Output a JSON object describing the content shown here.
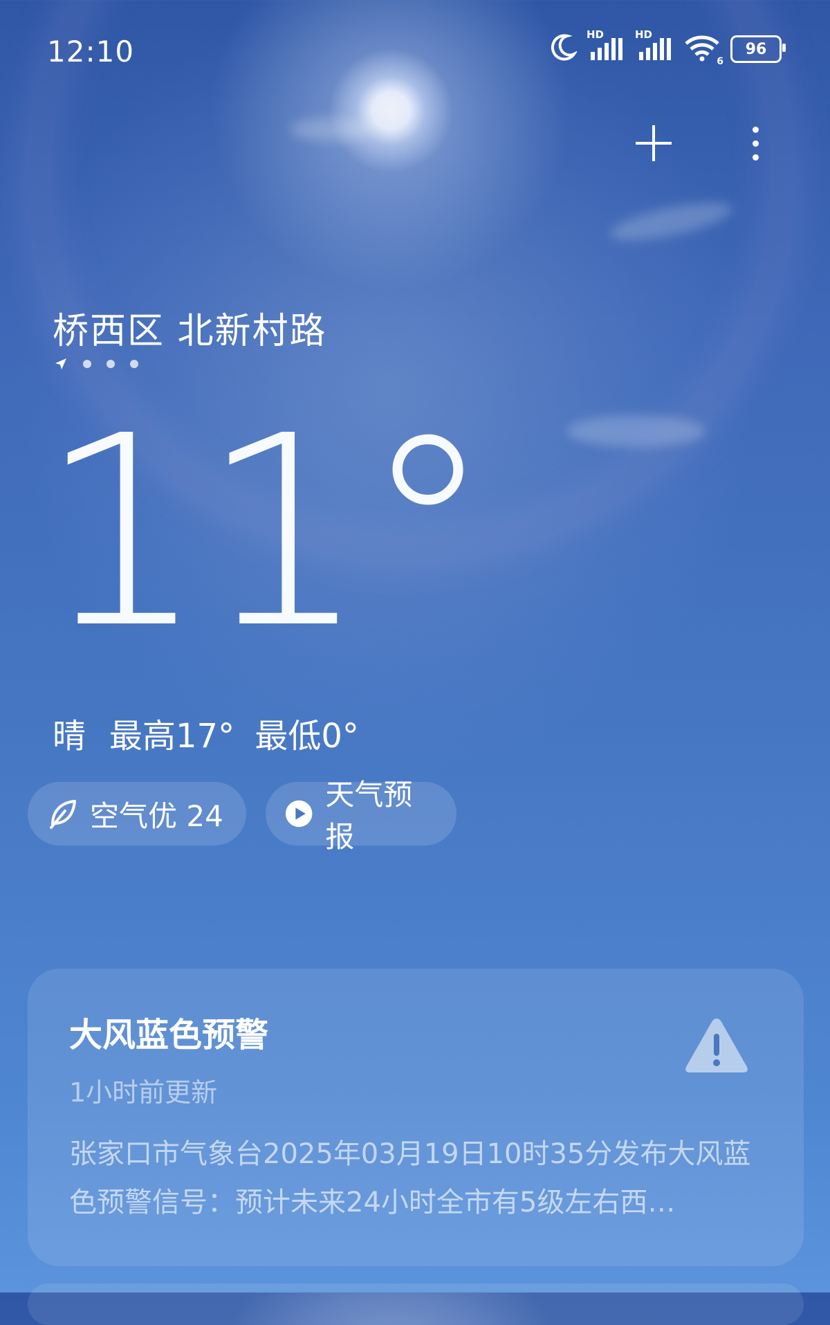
{
  "status_bar": {
    "time": "12:10",
    "battery": "96",
    "signal_label_1": "HD",
    "signal_label_2": "HD",
    "wifi_badge": "6",
    "icons": [
      "moon-icon",
      "signal-hd-icon",
      "signal-hd-icon",
      "wifi-icon",
      "battery-icon"
    ]
  },
  "header": {
    "add_icon": "plus-icon",
    "more_icon": "more-vertical-icon"
  },
  "location": {
    "name": "桥西区 北新村路",
    "page_count": 4,
    "current_page_icon": "location-arrow-icon"
  },
  "current": {
    "temperature": "11°",
    "condition": "晴",
    "high": "最高17°",
    "low": "最低0°"
  },
  "pills": {
    "aqi": {
      "icon": "leaf-icon",
      "label": "空气优 24"
    },
    "forecast": {
      "icon": "play-circle-icon",
      "label": "天气预报"
    }
  },
  "alert": {
    "title": "大风蓝色预警",
    "updated": "1小时前更新",
    "body": "张家口市气象台2025年03月19日10时35分发布大风蓝色预警信号：预计未来24小时全市有5级左右西…",
    "icon": "warning-triangle-icon"
  },
  "colors": {
    "sky_top": "#2f57a6",
    "sky_bottom": "#5b93dc",
    "text": "#ffffff"
  }
}
